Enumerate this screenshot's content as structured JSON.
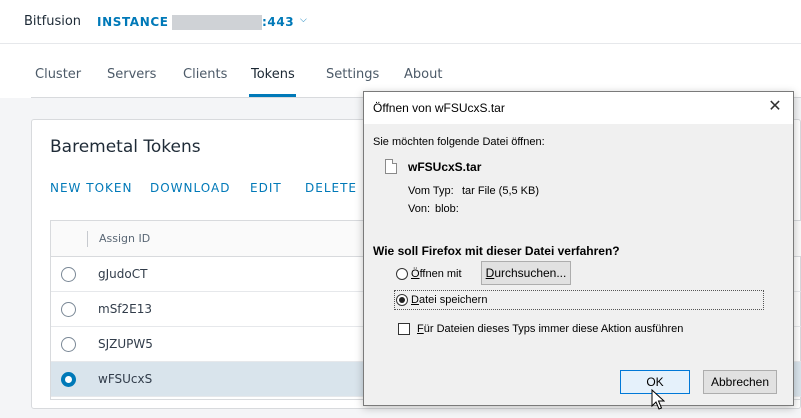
{
  "header": {
    "brand": "Bitfusion",
    "instance_label": "INSTANCE",
    "port": ":443"
  },
  "tabs": [
    {
      "label": "Cluster"
    },
    {
      "label": "Servers"
    },
    {
      "label": "Clients"
    },
    {
      "label": "Tokens",
      "active": true
    },
    {
      "label": "Settings"
    },
    {
      "label": "About"
    }
  ],
  "card": {
    "title": "Baremetal Tokens",
    "actions": [
      "NEW TOKEN",
      "DOWNLOAD",
      "EDIT",
      "DELETE"
    ],
    "column_header": "Assign ID",
    "rows": [
      {
        "id": "gJudoCT",
        "selected": false
      },
      {
        "id": "mSf2E13",
        "selected": false
      },
      {
        "id": "SJZUPW5",
        "selected": false
      },
      {
        "id": "wFSUcxS",
        "selected": true
      }
    ]
  },
  "dialog": {
    "title": "Öffnen von wFSUcxS.tar",
    "intro": "Sie möchten folgende Datei öffnen:",
    "filename": "wFSUcxS.tar",
    "type_label": "Vom Typ:",
    "type_value": "tar File (5,5 KB)",
    "from_label": "Von:",
    "from_value": "blob:",
    "question": "Wie soll Firefox mit dieser Datei verfahren?",
    "open_with_access": "Ö",
    "open_with_rest": "ffnen mit",
    "browse_access": "D",
    "browse_rest": "urchsuchen...",
    "save_access": "D",
    "save_rest": "atei speichern",
    "always_access": "F",
    "always_rest": "ür Dateien dieses Typs immer diese Aktion ausführen",
    "ok": "OK",
    "cancel": "Abbrechen",
    "selected_option": "save"
  }
}
